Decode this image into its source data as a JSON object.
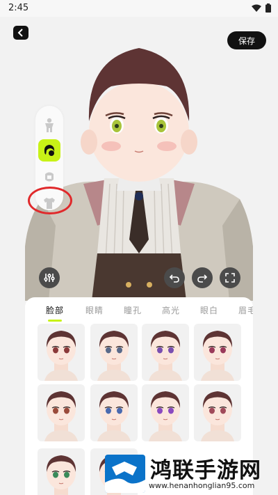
{
  "status": {
    "time": "2:45",
    "wifi_icon": "wifi-icon",
    "battery_icon": "battery-icon"
  },
  "header": {
    "back_icon": "chevron-left-icon",
    "save_label": "保存"
  },
  "side_panel": {
    "items": [
      {
        "name": "body",
        "icon": "person-icon",
        "active": false
      },
      {
        "name": "hair",
        "icon": "hair-icon",
        "active": true
      },
      {
        "name": "face",
        "icon": "face-icon",
        "active": false
      },
      {
        "name": "clothes",
        "icon": "shirt-icon",
        "active": false
      }
    ]
  },
  "controls": {
    "adjust_icon": "sliders-icon",
    "undo_icon": "undo-icon",
    "redo_icon": "redo-icon",
    "fullscreen_icon": "fullscreen-icon"
  },
  "tabs": [
    {
      "label": "脸部",
      "active": true
    },
    {
      "label": "眼睛",
      "active": false
    },
    {
      "label": "瞳孔",
      "active": false
    },
    {
      "label": "高光",
      "active": false
    },
    {
      "label": "眼白",
      "active": false
    },
    {
      "label": "眉毛",
      "active": false
    }
  ],
  "presets": {
    "eye_colors": [
      "#8b3a3a",
      "#5a6a8a",
      "#7a4fb0",
      "#9a3a5a",
      "#9a4a3a",
      "#4a6ab0",
      "#8a4ac0",
      "#a04a5a",
      "#3a8a5a",
      "#6a6a6a"
    ]
  },
  "colors": {
    "accent": "#c8f217",
    "dark": "#111111",
    "highlight_circle": "#e0292b"
  },
  "watermark": {
    "title": "鸿联手游网",
    "url": "www.henanhonglian95.com"
  }
}
